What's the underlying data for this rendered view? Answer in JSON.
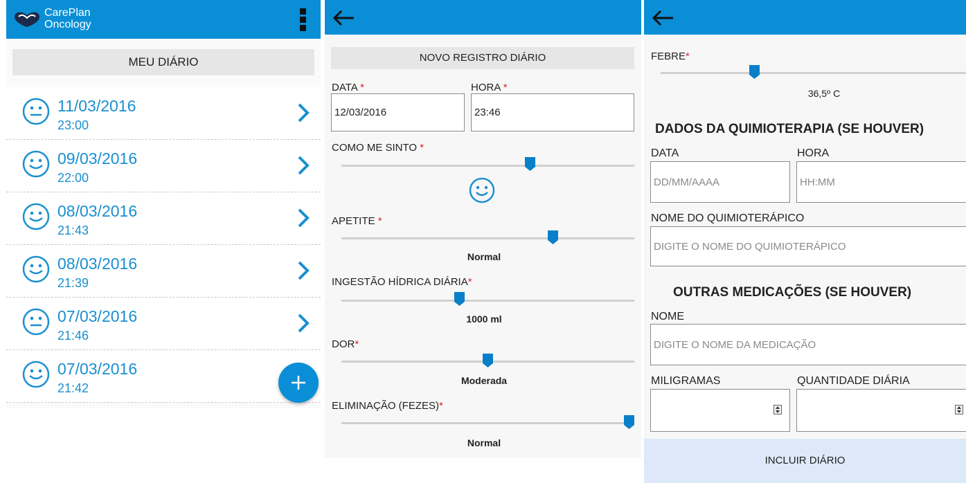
{
  "app": {
    "brand_line1": "CarePlan",
    "brand_line2": "Oncology"
  },
  "diary": {
    "title": "MEU DIÁRIO",
    "entries": [
      {
        "date": "11/03/2016",
        "time": "23:00",
        "mood": "neutral"
      },
      {
        "date": "09/03/2016",
        "time": "22:00",
        "mood": "happy"
      },
      {
        "date": "08/03/2016",
        "time": "21:43",
        "mood": "happy"
      },
      {
        "date": "08/03/2016",
        "time": "21:39",
        "mood": "happy"
      },
      {
        "date": "07/03/2016",
        "time": "21:46",
        "mood": "neutral"
      },
      {
        "date": "07/03/2016",
        "time": "21:42",
        "mood": "happy"
      }
    ]
  },
  "new_entry": {
    "title": "NOVO REGISTRO DIÁRIO",
    "date_label": "DATA",
    "date_value": "12/03/2016",
    "time_label": "HORA",
    "time_value": "23:46",
    "required_mark": "*",
    "feeling_label": "COMO ME SINTO",
    "feeling_level": 0.65,
    "appetite_label": "APETITE",
    "appetite_level": 0.73,
    "appetite_value": "Normal",
    "water_label": "INGESTÃO HÍDRICA DIÁRIA",
    "water_level": 0.4,
    "water_value": "1000 ml",
    "pain_label": "DOR",
    "pain_level": 0.5,
    "pain_value": "Moderada",
    "elimination_label": "ELIMINAÇÃO (FEZES)",
    "elimination_level": 1.0,
    "elimination_value": "Normal"
  },
  "details": {
    "fever_label": "FEBRE",
    "fever_level": 0.3,
    "fever_value": "36,5º C",
    "chemo_heading": "DADOS DA QUIMIOTERAPIA (SE HOUVER)",
    "chemo_date_label": "DATA",
    "chemo_date_placeholder": "DD/MM/AAAA",
    "chemo_time_label": "HORA",
    "chemo_time_placeholder": "HH:MM",
    "chemo_name_label": "NOME DO QUIMIOTERÁPICO",
    "chemo_name_placeholder": "DIGITE O NOME DO QUIMIOTERÁPICO",
    "meds_heading": "OUTRAS MEDICAÇÕES (SE HOUVER)",
    "med_name_label": "NOME",
    "med_name_placeholder": "DIGITE O NOME DA MEDICAÇÃO",
    "mg_label": "MILIGRAMAS",
    "qty_label": "QUANTIDADE DIÁRIA",
    "submit_label": "INCLUIR DIÁRIO"
  },
  "colors": {
    "primary": "#0a8fd6",
    "accent_text": "#1a8fd0",
    "required": "#d9232a"
  }
}
